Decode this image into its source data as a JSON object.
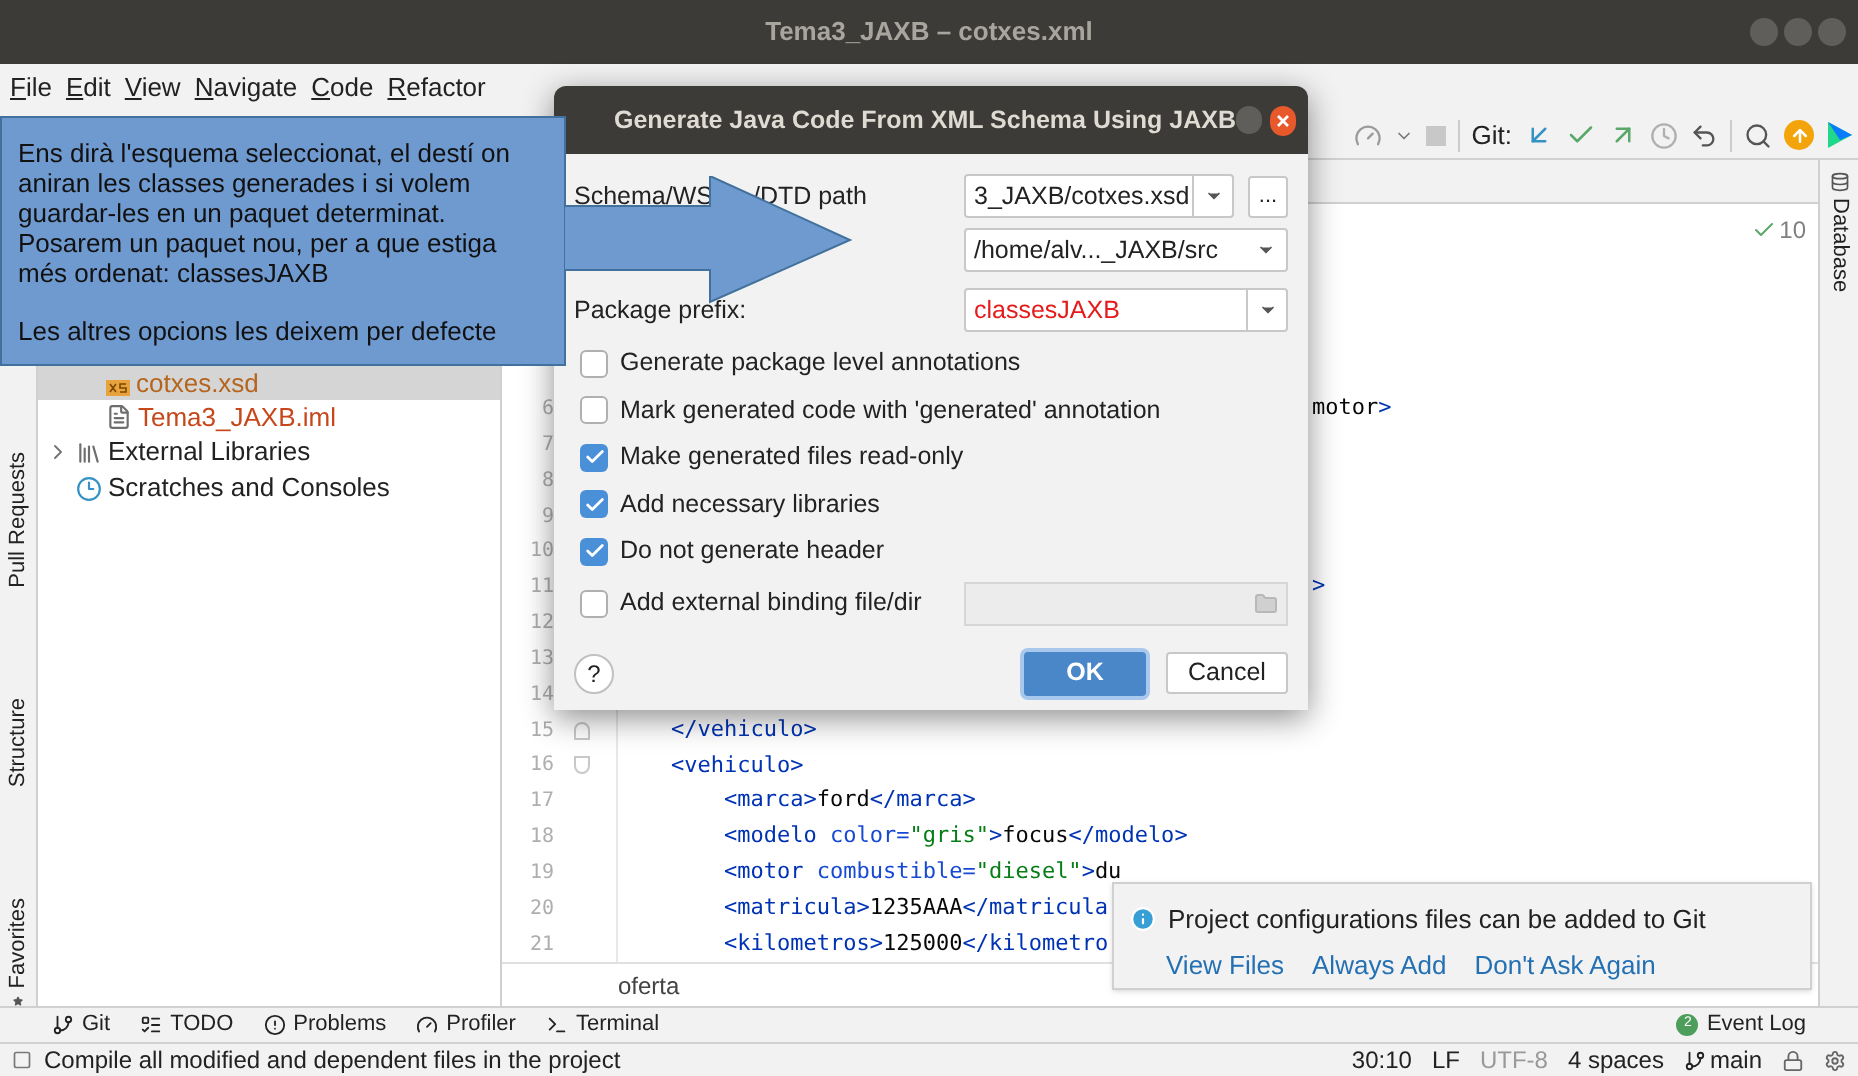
{
  "window": {
    "title": "Tema3_JAXB – cotxes.xml"
  },
  "menu": [
    "File",
    "Edit",
    "View",
    "Navigate",
    "Code",
    "Refactor"
  ],
  "toolbar": {
    "git_label": "Git:"
  },
  "left_strip": [
    "Pull Requests",
    "Structure",
    "Favorites"
  ],
  "project_files": [
    {
      "label": "cotxes.xsd",
      "kind": "xsd",
      "selected": true,
      "color": "#b5651d"
    },
    {
      "label": "Tema3_JAXB.iml",
      "kind": "iml",
      "selected": false,
      "color": "#c7471a"
    }
  ],
  "project_roots": [
    {
      "label": "External Libraries",
      "kind": "libraries",
      "expanded": false
    },
    {
      "label": "Scratches and Consoles",
      "kind": "scratches"
    }
  ],
  "editor": {
    "problems_count": "10",
    "breadcrumb": "oferta",
    "lines": [
      {
        "number": "6",
        "text": "motor>",
        "kind": "tail"
      },
      {
        "number": "7"
      },
      {
        "number": "8"
      },
      {
        "number": "9"
      },
      {
        "number": "10"
      },
      {
        "number": "11",
        "text": ">",
        "kind": "tail"
      },
      {
        "number": "12"
      },
      {
        "number": "13"
      },
      {
        "number": "14"
      },
      {
        "number": "15",
        "text": "    </vehiculo>",
        "kind": "fold_end"
      },
      {
        "number": "16",
        "text": "    <vehiculo>",
        "kind": "fold_start"
      },
      {
        "number": "17",
        "text": "        <marca>ford</marca>"
      },
      {
        "number": "18",
        "text": "        <modelo color=\"gris\">focus</modelo>"
      },
      {
        "number": "19",
        "text": "        <motor combustible=\"diesel\">du"
      },
      {
        "number": "20",
        "text": "        <matricula>1235AAA</matricula"
      },
      {
        "number": "21",
        "text": "        <kilometros>125000</kilometro"
      }
    ]
  },
  "right_strip": [
    "Database"
  ],
  "notification": {
    "message": "Project configurations files can be added to Git",
    "actions": [
      "View Files",
      "Always Add",
      "Don't Ask Again"
    ]
  },
  "tool_tabs": [
    {
      "label": "Git",
      "kind": "git"
    },
    {
      "label": "TODO",
      "kind": "todo"
    },
    {
      "label": "Problems",
      "kind": "problems"
    },
    {
      "label": "Profiler",
      "kind": "profiler"
    },
    {
      "label": "Terminal",
      "kind": "terminal"
    }
  ],
  "event_log": {
    "label": "Event Log",
    "badge": "2"
  },
  "status_bar": {
    "message": "Compile all modified and dependent files in the project",
    "position": "30:10",
    "line_ending": "LF",
    "encoding": "UTF-8",
    "indent": "4 spaces",
    "branch": "main"
  },
  "dialog": {
    "title": "Generate Java Code From XML Schema Using JAXB",
    "schema_label_parts": [
      "Schema/WS",
      "/DTD path"
    ],
    "schema_path": "3_JAXB/cotxes.xsd",
    "browse": "...",
    "output_dir": "/home/alv..._JAXB/src",
    "package_label": "Package prefix:",
    "package_prefix": "classesJAXB",
    "options": [
      {
        "label": "Generate package level annotations",
        "checked": false
      },
      {
        "label": "Mark generated code with 'generated' annotation",
        "checked": false
      },
      {
        "label": "Make generated files read-only",
        "checked": true
      },
      {
        "label": "Add necessary libraries",
        "checked": true
      },
      {
        "label": "Do not generate header",
        "checked": true
      },
      {
        "label": "Add external binding file/dir",
        "checked": false,
        "kind": "with_field"
      }
    ],
    "help": "?",
    "ok": "OK",
    "cancel": "Cancel"
  },
  "callout": {
    "paragraphs": [
      "Ens dirà l'esquema seleccionat, el destí on aniran les classes generades i si volem guardar-les en un paquet determinat. Posarem un paquet nou, per a que estiga més ordenat: classesJAXB",
      "Les altres opcions les deixem per defecte"
    ]
  }
}
